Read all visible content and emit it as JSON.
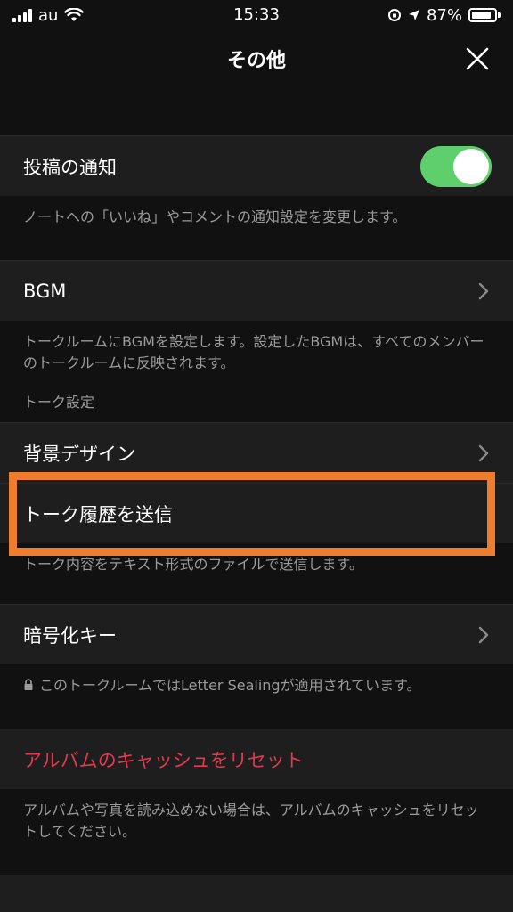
{
  "status_bar": {
    "carrier": "au",
    "time": "15:33",
    "battery_percent": "87%",
    "battery_level": 0.87
  },
  "nav": {
    "title": "その他"
  },
  "rows": {
    "post_notify": {
      "label": "投稿の通知",
      "toggle_on": true
    },
    "post_notify_desc": "ノートへの「いいね」やコメントの通知設定を変更します。",
    "bgm": {
      "label": "BGM"
    },
    "bgm_desc": "トークルームにBGMを設定します。設定したBGMは、すべてのメンバーのトークルームに反映されます。",
    "talk_settings_header": "トーク設定",
    "background": {
      "label": "背景デザイン"
    },
    "send_history": {
      "label": "トーク履歴を送信"
    },
    "send_history_desc": "トーク内容をテキスト形式のファイルで送信します。",
    "encryption": {
      "label": "暗号化キー"
    },
    "encryption_desc": "このトークルームではLetter Sealingが適用されています。",
    "reset_album": {
      "label": "アルバムのキャッシュをリセット"
    },
    "reset_album_desc": "アルバムや写真を読み込めない場合は、アルバムのキャッシュをリセットしてください。"
  },
  "colors": {
    "toggle_on": "#5fcf6d",
    "destructive": "#e3384f",
    "highlight": "#f07c2d"
  }
}
